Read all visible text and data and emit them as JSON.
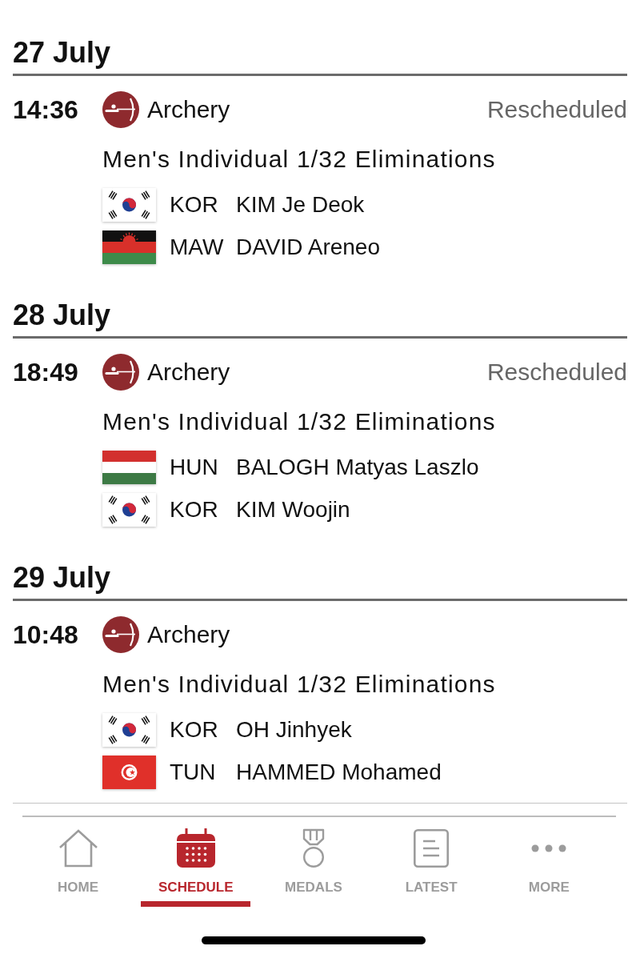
{
  "days": [
    {
      "date": "27 July",
      "events": [
        {
          "time": "14:36",
          "sport": "Archery",
          "status": "Rescheduled",
          "title": "Men's Individual 1/32 Eliminations",
          "competitors": [
            {
              "kind": "korea",
              "country": "KOR",
              "name": "KIM Je Deok"
            },
            {
              "kind": "malawi",
              "country": "MAW",
              "name": "DAVID Areneo"
            }
          ]
        }
      ]
    },
    {
      "date": "28 July",
      "events": [
        {
          "time": "18:49",
          "sport": "Archery",
          "status": "Rescheduled",
          "title": "Men's Individual 1/32 Eliminations",
          "competitors": [
            {
              "kind": "hungary",
              "country": "HUN",
              "name": "BALOGH Matyas Laszlo"
            },
            {
              "kind": "korea",
              "country": "KOR",
              "name": "KIM Woojin"
            }
          ]
        }
      ]
    },
    {
      "date": "29 July",
      "events": [
        {
          "time": "10:48",
          "sport": "Archery",
          "title": "Men's Individual 1/32 Eliminations",
          "competitors": [
            {
              "kind": "korea",
              "country": "KOR",
              "name": "OH Jinhyek"
            },
            {
              "kind": "tunisia",
              "country": "TUN",
              "name": "HAMMED Mohamed"
            }
          ]
        }
      ]
    }
  ],
  "tab_bar": {
    "tabs": [
      {
        "kind": "home",
        "label": "HOME",
        "selected": false
      },
      {
        "kind": "calendar",
        "label": "SCHEDULE",
        "selected": true
      },
      {
        "kind": "medal",
        "label": "MEDALS",
        "selected": false
      },
      {
        "kind": "document",
        "label": "LATEST",
        "selected": false
      },
      {
        "kind": "more",
        "label": "MORE",
        "selected": false
      }
    ]
  }
}
